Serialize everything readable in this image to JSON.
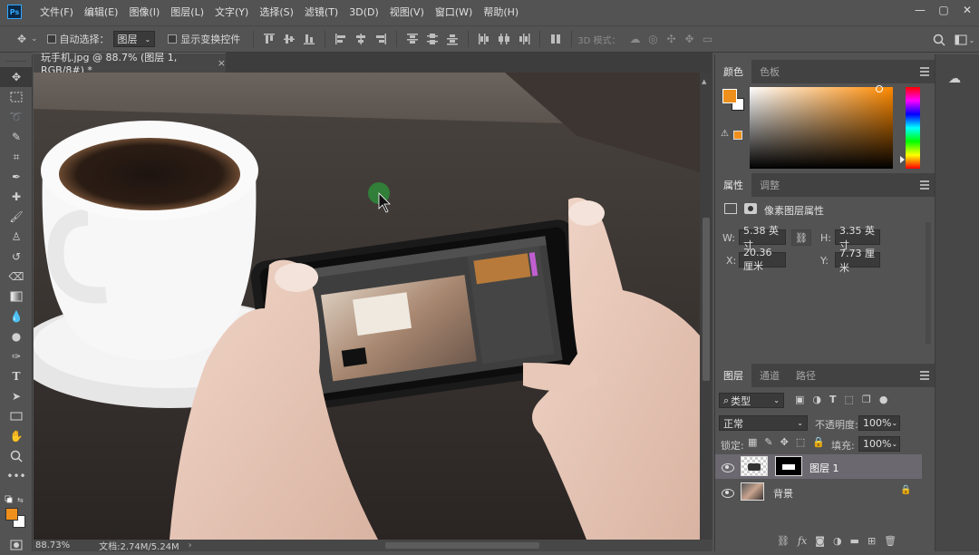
{
  "app": {
    "logo": "Ps"
  },
  "menu": [
    "文件(F)",
    "编辑(E)",
    "图像(I)",
    "图层(L)",
    "文字(Y)",
    "选择(S)",
    "滤镜(T)",
    "3D(D)",
    "视图(V)",
    "窗口(W)",
    "帮助(H)"
  ],
  "window_controls": {
    "minimize": "—",
    "restore": "▢",
    "close": "✕"
  },
  "options": {
    "auto_select_label": "自动选择：",
    "auto_select_value": "图层",
    "show_transform_label": "显示变换控件",
    "mode_3d_label": "3D 模式："
  },
  "document": {
    "tab_title": "玩手机.jpg @ 88.7% (图层 1, RGB/8#) *",
    "tab_close": "×",
    "zoom": "88.73%",
    "doc_size": "文档:2.74M/5.24M"
  },
  "color_panel": {
    "tabs": [
      "颜色",
      "色板"
    ],
    "foreground": "#f0901c",
    "background": "#ffffff",
    "hue_color": "#ff8a00"
  },
  "properties_panel": {
    "tabs": [
      "属性",
      "调整"
    ],
    "title": "像素图层属性",
    "w_label": "W:",
    "w_value": "5.38 英寸",
    "h_label": "H:",
    "h_value": "3.35 英寸",
    "x_label": "X:",
    "x_value": "20.36 厘米",
    "y_label": "Y:",
    "y_value": "7.73 厘米"
  },
  "layers_panel": {
    "tabs": [
      "图层",
      "通道",
      "路径"
    ],
    "filter_label": "类型",
    "blend_mode": "正常",
    "opacity_label": "不透明度:",
    "opacity_value": "100%",
    "lock_label": "锁定:",
    "fill_label": "填充:",
    "fill_value": "100%",
    "layers": [
      {
        "name": "图层 1",
        "selected": true
      },
      {
        "name": "背景",
        "selected": false
      }
    ]
  },
  "toolbar": [
    "move",
    "marquee",
    "lasso",
    "quick-select",
    "crop",
    "eyedropper",
    "healing",
    "brush",
    "stamp",
    "history-brush",
    "eraser",
    "gradient",
    "blur",
    "dodge",
    "pen",
    "type",
    "path-select",
    "shape",
    "hand",
    "zoom",
    "more"
  ]
}
